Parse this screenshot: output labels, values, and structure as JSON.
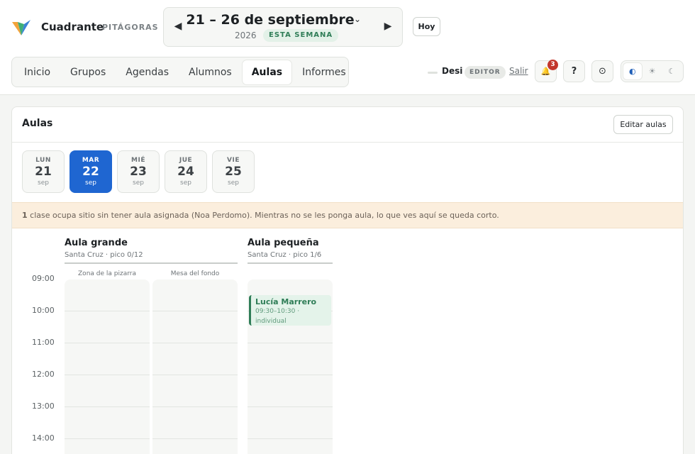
{
  "app": {
    "name": "Cuadrante",
    "org": "PITÁGORAS"
  },
  "week": {
    "title": "21 – 26 de septiembre",
    "year": "2026",
    "badge": "ESTA SEMANA",
    "prev_icon": "◀",
    "next_icon": "▶",
    "chevron_icon": "⌄"
  },
  "today_label": "Hoy",
  "nav": {
    "tabs": [
      "Inicio",
      "Grupos",
      "Agendas",
      "Alumnos",
      "Aulas",
      "Informes"
    ],
    "active": "Aulas"
  },
  "user": {
    "name": "Desi",
    "role": "EDITOR",
    "logout_label": "Salir"
  },
  "toolbar": {
    "notifications_count": "3",
    "help_label": "?",
    "bell_icon": "🔔",
    "sync_icon": "⊙"
  },
  "theme": {
    "options": [
      "◐",
      "☀",
      "☾"
    ],
    "active_index": 0
  },
  "panel": {
    "title": "Aulas",
    "edit_label": "Editar aulas",
    "days": [
      {
        "weekday": "LUN",
        "day": "21",
        "month": "sep",
        "selected": false
      },
      {
        "weekday": "MAR",
        "day": "22",
        "month": "sep",
        "selected": true
      },
      {
        "weekday": "MIÉ",
        "day": "23",
        "month": "sep",
        "selected": false
      },
      {
        "weekday": "JUE",
        "day": "24",
        "month": "sep",
        "selected": false
      },
      {
        "weekday": "VIE",
        "day": "25",
        "month": "sep",
        "selected": false
      }
    ],
    "warning": {
      "count": "1",
      "text": " clase ocupa sitio sin tener aula asignada (Noa Perdomo). Mientras no se les ponga aula, lo que ves aquí se queda corto."
    },
    "rooms": [
      {
        "name": "Aula grande",
        "sub": "Santa Cruz · pico 0/12",
        "zones": [
          "Zona de la pizarra",
          "Mesa del fondo"
        ]
      },
      {
        "name": "Aula pequeña",
        "sub": "Santa Cruz · pico 1/6",
        "zones": [
          ""
        ]
      }
    ],
    "times": [
      "09:00",
      "10:00",
      "11:00",
      "12:00",
      "13:00",
      "14:00"
    ],
    "event": {
      "name": "Lucía Marrero",
      "time": "09:30–10:30 ·",
      "type": "individual"
    }
  }
}
